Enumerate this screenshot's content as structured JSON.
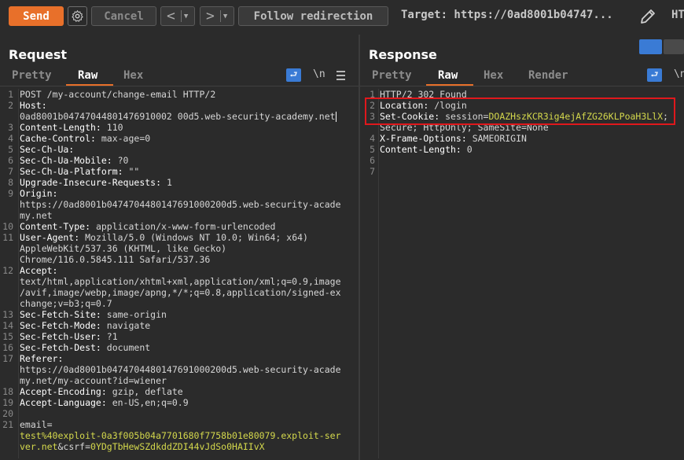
{
  "toolbar": {
    "send_label": "Send",
    "cancel_label": "Cancel",
    "follow_label": "Follow redirection",
    "target_text": "Target: https://0ad8001b04747...",
    "ht_text": "HT"
  },
  "request": {
    "title": "Request",
    "tabs": [
      "Pretty",
      "Raw",
      "Hex"
    ],
    "active_tab": "Raw",
    "rows": [
      {
        "n": "1",
        "t": "POST /my-account/change-email HTTP/2"
      },
      {
        "n": "2",
        "h": "Host:"
      },
      {
        "n": "",
        "t": "0ad8001b04747044801476910002 00d5.web-security-academy.net"
      },
      {
        "n": "3",
        "h": "Content-Length:",
        "v": " 110"
      },
      {
        "n": "4",
        "h": "Cache-Control:",
        "v": " max-age=0"
      },
      {
        "n": "5",
        "h": "Sec-Ch-Ua:"
      },
      {
        "n": "6",
        "h": "Sec-Ch-Ua-Mobile:",
        "v": " ?0"
      },
      {
        "n": "7",
        "h": "Sec-Ch-Ua-Platform:",
        "v": " \"\""
      },
      {
        "n": "8",
        "h": "Upgrade-Insecure-Requests:",
        "v": " 1"
      },
      {
        "n": "9",
        "h": "Origin:"
      },
      {
        "n": "",
        "t": "https://0ad8001b0474704480147691000200d5.web-security-acade"
      },
      {
        "n": "",
        "t": "my.net"
      },
      {
        "n": "10",
        "h": "Content-Type:",
        "v": " application/x-www-form-urlencoded"
      },
      {
        "n": "11",
        "h": "User-Agent:",
        "v": " Mozilla/5.0 (Windows NT 10.0; Win64; x64)"
      },
      {
        "n": "",
        "t": "AppleWebKit/537.36 (KHTML, like Gecko)"
      },
      {
        "n": "",
        "t": "Chrome/116.0.5845.111 Safari/537.36"
      },
      {
        "n": "12",
        "h": "Accept:"
      },
      {
        "n": "",
        "t": "text/html,application/xhtml+xml,application/xml;q=0.9,image"
      },
      {
        "n": "",
        "t": "/avif,image/webp,image/apng,*/*;q=0.8,application/signed-ex"
      },
      {
        "n": "",
        "t": "change;v=b3;q=0.7"
      },
      {
        "n": "13",
        "h": "Sec-Fetch-Site:",
        "v": " same-origin"
      },
      {
        "n": "14",
        "h": "Sec-Fetch-Mode:",
        "v": " navigate"
      },
      {
        "n": "15",
        "h": "Sec-Fetch-User:",
        "v": " ?1"
      },
      {
        "n": "16",
        "h": "Sec-Fetch-Dest:",
        "v": " document"
      },
      {
        "n": "17",
        "h": "Referer:"
      },
      {
        "n": "",
        "t": "https://0ad8001b0474704480147691000200d5.web-security-acade"
      },
      {
        "n": "",
        "t": "my.net/my-account?id=wiener"
      },
      {
        "n": "18",
        "h": "Accept-Encoding:",
        "v": " gzip, deflate"
      },
      {
        "n": "19",
        "h": "Accept-Language:",
        "v": " en-US,en;q=0.9"
      },
      {
        "n": "20",
        "t": ""
      },
      {
        "n": "21",
        "p": "email="
      },
      {
        "n": "",
        "v": "test%40exploit-0a3f005b04a7701680f7758b01e80079.exploit-ser"
      },
      {
        "n": "",
        "v2": "ver.net",
        "p2": "&csrf=",
        "v3": "0YDgTbHewSZdkddZDI44vJdSo0HAIIvX"
      }
    ]
  },
  "response": {
    "title": "Response",
    "tabs": [
      "Pretty",
      "Raw",
      "Hex",
      "Render"
    ],
    "active_tab": "Raw",
    "rows": [
      {
        "n": "1",
        "t": "HTTP/2 302 Found"
      },
      {
        "n": "2",
        "h": "Location:",
        "v": " /login"
      },
      {
        "n": "3",
        "h": "Set-Cookie:",
        "v": " session=",
        "v2": "DOAZHszKCR3ig4ejAfZG26KLPoaH3LlX",
        "v3": ";"
      },
      {
        "n": "",
        "t": "Secure; HttpOnly; SameSite=None"
      },
      {
        "n": "4",
        "h": "X-Frame-Options:",
        "v": " SAMEORIGIN"
      },
      {
        "n": "5",
        "h": "Content-Length:",
        "v": " 0"
      },
      {
        "n": "6",
        "t": ""
      },
      {
        "n": "7",
        "t": ""
      }
    ]
  },
  "icons": {
    "wrap": "wrap-lines-icon",
    "newline": "\\n",
    "settings": "gear-icon",
    "edit": "pencil-icon"
  }
}
